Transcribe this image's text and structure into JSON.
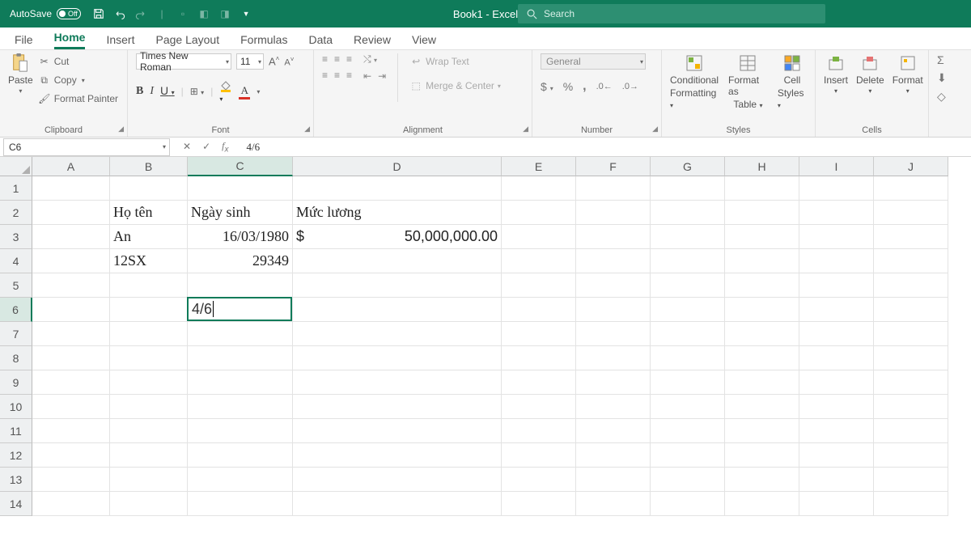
{
  "titlebar": {
    "autosave_label": "AutoSave",
    "autosave_state": "Off",
    "doc_title": "Book1  -  Excel",
    "search_placeholder": "Search"
  },
  "tabs": [
    "File",
    "Home",
    "Insert",
    "Page Layout",
    "Formulas",
    "Data",
    "Review",
    "View"
  ],
  "active_tab": "Home",
  "ribbon": {
    "clipboard": {
      "label": "Clipboard",
      "paste": "Paste",
      "cut": "Cut",
      "copy": "Copy",
      "format_painter": "Format Painter"
    },
    "font": {
      "label": "Font",
      "name": "Times New Roman",
      "size": "11",
      "bold": "B",
      "italic": "I",
      "underline": "U"
    },
    "alignment": {
      "label": "Alignment",
      "wrap": "Wrap Text",
      "merge": "Merge & Center"
    },
    "number": {
      "label": "Number",
      "format": "General",
      "percent": "%",
      "comma": ","
    },
    "styles": {
      "label": "Styles",
      "conditional1": "Conditional",
      "conditional2": "Formatting",
      "formatas1": "Format as",
      "formatas2": "Table",
      "cell1": "Cell",
      "cell2": "Styles"
    },
    "cells": {
      "label": "Cells",
      "insert": "Insert",
      "delete": "Delete",
      "format": "Format"
    }
  },
  "formula_bar": {
    "name_box": "C6",
    "formula": "4/6"
  },
  "grid": {
    "columns": [
      "A",
      "B",
      "C",
      "D",
      "E",
      "F",
      "G",
      "H",
      "I",
      "J"
    ],
    "row_count": 14,
    "active_row": 6,
    "active_col": "C",
    "active_value": "4/6",
    "cells": {
      "B2": "Họ tên",
      "C2": "Ngày sinh",
      "D2": "Mức lương",
      "B3": "An",
      "C3": "16/03/1980",
      "D3_prefix": "$",
      "D3_value": "50,000,000.00",
      "B4": "12SX",
      "C4": "29349"
    }
  }
}
